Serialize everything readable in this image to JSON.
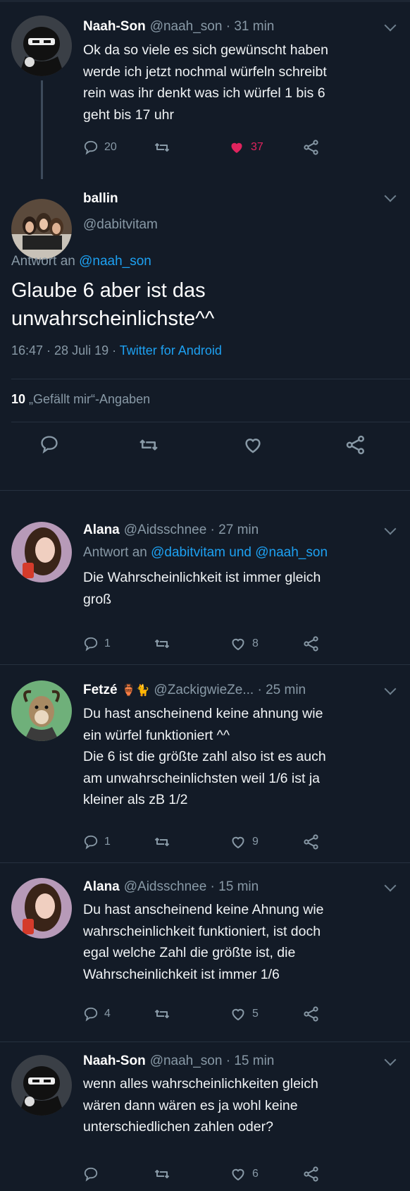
{
  "tweet1": {
    "name": "Naah-Son",
    "handle": "@naah_son",
    "time": "31 min",
    "text": "Ok da so viele es sich gewünscht haben\nwerde ich jetzt nochmal würfeln schreibt\nrein was ihr denkt was ich würfel 1 bis 6\ngeht bis 17 uhr",
    "replies": "20",
    "likes": "37"
  },
  "main": {
    "name": "ballin",
    "handle": "@dabitvitam",
    "reply_prefix": "Antwort an",
    "reply_to": "@naah_son",
    "text": "Glaube 6 aber ist das unwahrscheinlichste^^",
    "timestamp": "16:47 · 28 Juli 19 ·",
    "client": "Twitter for Android",
    "likes_count": "10",
    "likes_label": "„Gefällt mir“-Angaben"
  },
  "tweet3": {
    "name": "Alana",
    "handle": "@Aidsschnee",
    "time": "27 min",
    "reply_prefix": "Antwort an",
    "reply_to": "@dabitvitam und @naah_son",
    "text": "Die Wahrscheinlichkeit ist immer gleich\ngroß",
    "replies": "1",
    "likes": "8"
  },
  "tweet4": {
    "name": "Fetzé",
    "emoji": "🏺🐈",
    "handle": "@ZackigwieZe...",
    "time": "25 min",
    "text": "Du hast anscheinend keine ahnung wie\nein würfel funktioniert ^^\nDie 6 ist die größte zahl also ist es auch\nam unwahrscheinlichsten weil 1/6 ist ja\nkleiner als zB 1/2",
    "replies": "1",
    "likes": "9"
  },
  "tweet5": {
    "name": "Alana",
    "handle": "@Aidsschnee",
    "time": "15 min",
    "text": "Du hast anscheinend keine Ahnung wie\nwahrscheinlichkeit funktioniert, ist doch\negal welche Zahl die größte ist, die\nWahrscheinlichkeit ist immer 1/6",
    "replies": "4",
    "likes": "5"
  },
  "tweet6": {
    "name": "Naah-Son",
    "handle": "@naah_son",
    "time": "15 min",
    "text": "wenn alles wahrscheinlichkeiten gleich\nwären dann wären es ja wohl keine\nunterschiedlichen zahlen oder?",
    "likes": "6"
  },
  "colors": {
    "background": "#131b27",
    "accent": "#1da1f2",
    "like": "#e0245e",
    "muted": "#8899a6"
  },
  "icons": [
    "reply-icon",
    "retweet-icon",
    "like-icon",
    "share-icon",
    "chevron-down-icon"
  ]
}
